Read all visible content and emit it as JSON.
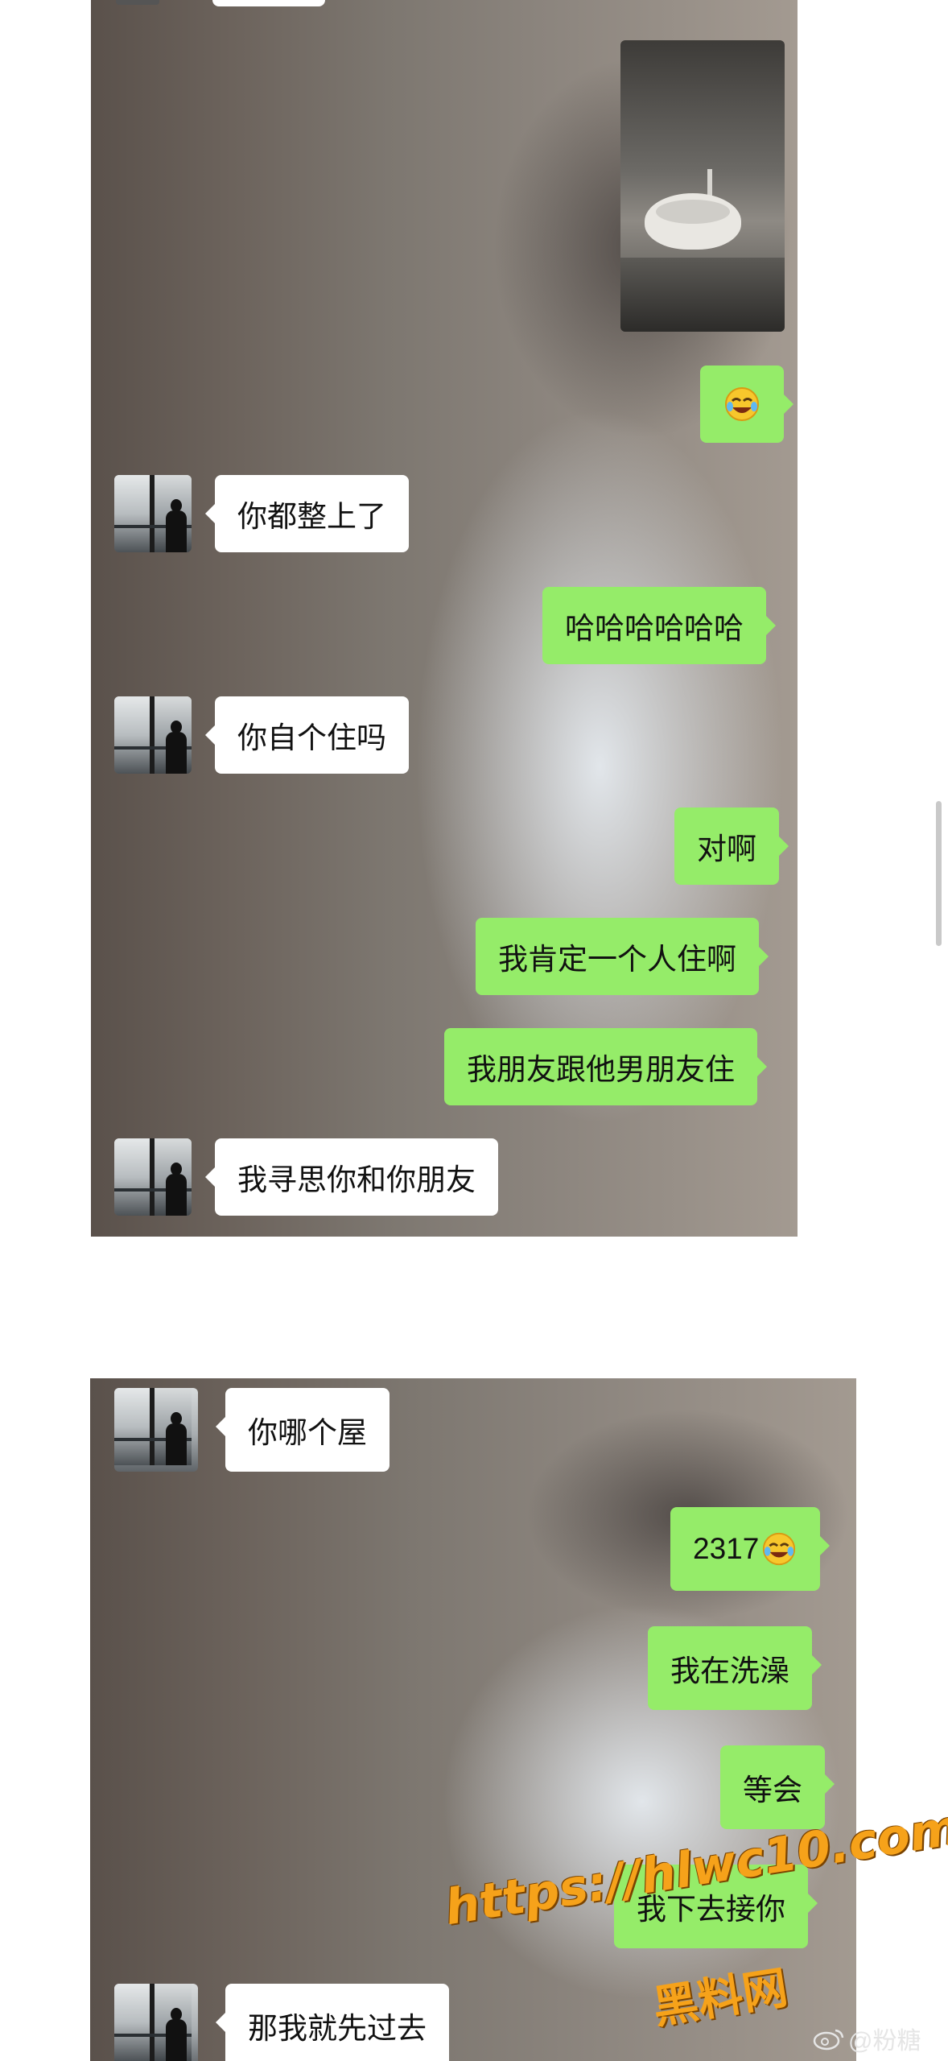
{
  "screenshot1": {
    "messages": [
      {
        "side": "out",
        "type": "image",
        "label": "bathroom-photo"
      },
      {
        "side": "out",
        "type": "emoji",
        "text": ""
      },
      {
        "side": "in",
        "text": "你都整上了"
      },
      {
        "side": "out",
        "text": "哈哈哈哈哈哈"
      },
      {
        "side": "in",
        "text": "你自个住吗"
      },
      {
        "side": "out",
        "text": "对啊"
      },
      {
        "side": "out",
        "text": "我肯定一个人住啊"
      },
      {
        "side": "out",
        "text": "我朋友跟他男朋友住"
      },
      {
        "side": "in",
        "text": "我寻思你和你朋友"
      }
    ]
  },
  "screenshot2": {
    "messages": [
      {
        "side": "in",
        "text": "你哪个屋"
      },
      {
        "side": "out",
        "text": "2317"
      },
      {
        "side": "out",
        "text": "我在洗澡"
      },
      {
        "side": "out",
        "text": "等会"
      },
      {
        "side": "out",
        "text": "我下去接你"
      },
      {
        "side": "in",
        "text": "那我就先过去"
      }
    ]
  },
  "watermark": {
    "url": "https://hlwc10.com",
    "site_name": "黑料网",
    "weibo_handle": "@粉糖"
  },
  "icons": {
    "emoji": "tears-of-joy-emoji",
    "avatar": "window-silhouette-avatar",
    "weibo": "weibo-logo-icon"
  },
  "colors": {
    "outgoing_bubble": "#95ec69",
    "incoming_bubble": "#ffffff",
    "watermark": "#f6a21a"
  }
}
